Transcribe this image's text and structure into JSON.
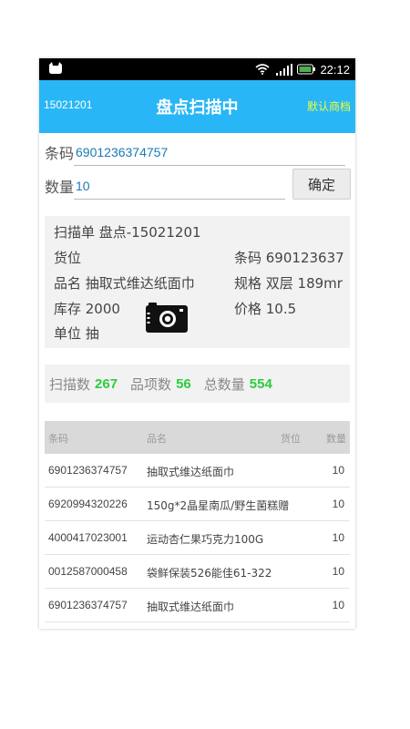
{
  "status_bar": {
    "time": "22:12",
    "left_icon": "cat-notification-icon",
    "icons": [
      "wifi-icon",
      "signal-icon",
      "battery-icon"
    ],
    "battery_color": "#4caf50"
  },
  "header": {
    "left_text": "15021201",
    "title": "盘点扫描中",
    "right_text": "默认商档",
    "bg_color": "#29b6f6",
    "right_color": "#eaff3a"
  },
  "form": {
    "barcode_label": "条码",
    "barcode_value": "6901236374757",
    "quantity_label": "数量",
    "quantity_value": "10",
    "confirm_label": "确定"
  },
  "info": {
    "scan_order": "扫描单 盘点-15021201",
    "location": "货位",
    "name": "品名 抽取式维达纸面巾",
    "stock": "库存 2000",
    "unit": "单位 抽",
    "barcode": "条码 690123637",
    "spec": "规格 双层 189mr",
    "price": "价格 10.5"
  },
  "stats": {
    "scan_count_label": "扫描数",
    "scan_count": "267",
    "item_count_label": "品项数",
    "item_count": "56",
    "total_qty_label": "总数量",
    "total_qty": "554"
  },
  "table": {
    "headers": {
      "code": "条码",
      "name": "品名",
      "location": "货位",
      "qty": "数量"
    },
    "rows": [
      {
        "code": "6901236374757",
        "name": "抽取式维达纸面巾",
        "qty": "10"
      },
      {
        "code": "6920994320226",
        "name": "150g*2晶星南瓜/野生菌糕赠",
        "qty": "10"
      },
      {
        "code": "4000417023001",
        "name": "运动杏仁果巧克力100G",
        "qty": "10"
      },
      {
        "code": "0012587000458",
        "name": "袋鲜保装526能佳61-322",
        "qty": "10"
      },
      {
        "code": "6901236374757",
        "name": "抽取式维达纸面巾",
        "qty": "10"
      }
    ]
  }
}
